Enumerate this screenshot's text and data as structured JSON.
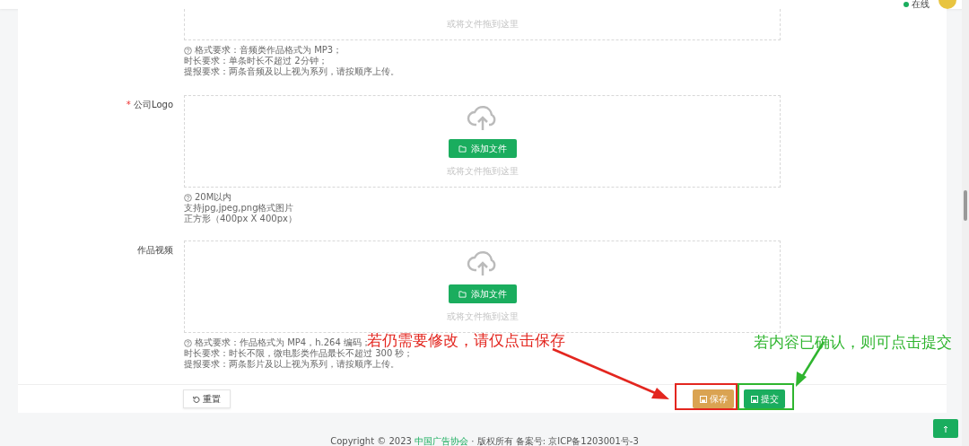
{
  "header": {
    "status": {
      "label": "在线",
      "color": "#1aad5e"
    }
  },
  "sections": [
    {
      "kind": "partial",
      "drop_hint": "或将文件拖到这里",
      "hints": [
        "格式要求：音频类作品格式为 MP3；",
        "时长要求：单条时长不超过 2分钟；",
        "提报要求：两条音频及以上视为系列，请按顺序上传。"
      ]
    },
    {
      "kind": "full",
      "label": "公司Logo",
      "required_mark": "*",
      "button": "添加文件",
      "drop_hint": "或将文件拖到这里",
      "hints": [
        "20M以内",
        "支持jpg,jpeg,png格式图片",
        "正方形（400px X 400px）"
      ]
    },
    {
      "kind": "full",
      "label": "作品视频",
      "button": "添加文件",
      "drop_hint": "或将文件拖到这里",
      "hints": [
        "格式要求：作品格式为 MP4，h.264 编码；",
        "时长要求：时长不限，微电影类作品最长不超过 300 秒；",
        "提报要求：两条影片及以上视为系列，请按顺序上传。"
      ]
    }
  ],
  "actions": {
    "reset": "重置",
    "save": "保存",
    "submit": "提交"
  },
  "annotations": [
    {
      "text": "若仍需要修改，请仅点击保存",
      "color": "#e3261f"
    },
    {
      "text": "若内容已确认，则可点击提交",
      "color": "#2fb52f"
    }
  ],
  "footer": {
    "prefix": "Copyright © 2023",
    "link": "中国广告协会",
    "suffix": "· 版权所有 备案号: 京ICP备1203001号-3"
  }
}
